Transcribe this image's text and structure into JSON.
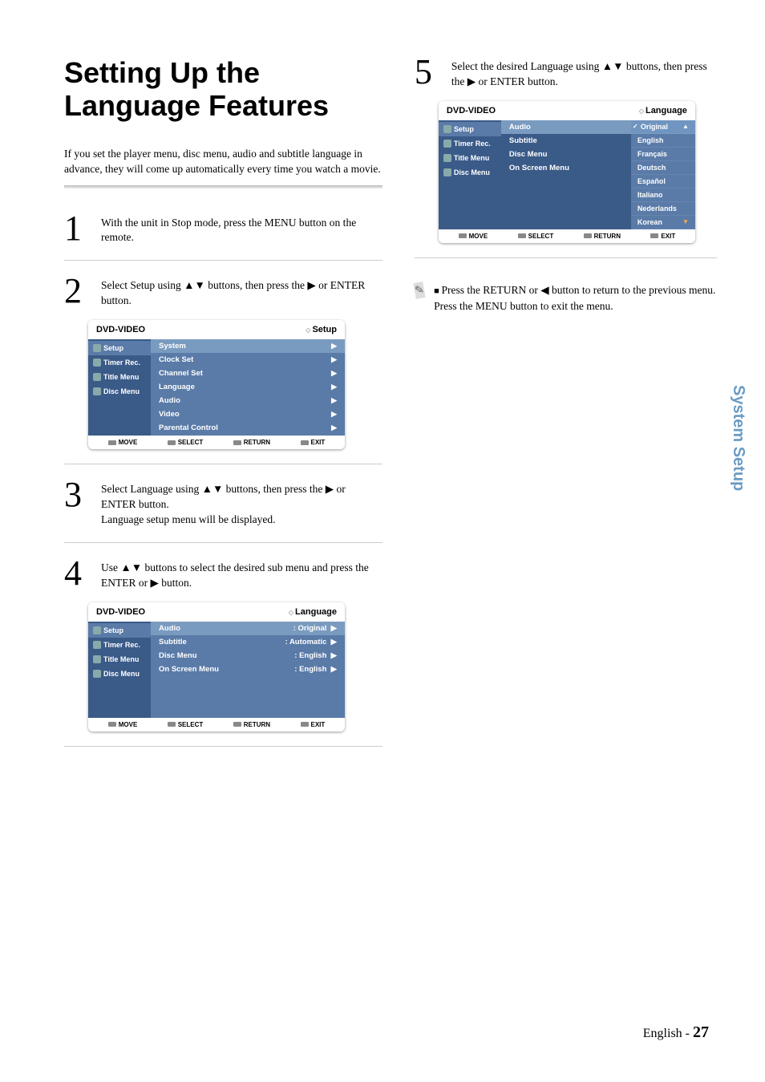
{
  "title": "Setting Up the Language Features",
  "intro": "If you set the player menu, disc menu, audio and subtitle language in advance, they will come up automatically every time you watch a movie.",
  "steps": {
    "s1": {
      "num": "1",
      "text": "With the unit in Stop mode, press the MENU button on the remote."
    },
    "s2": {
      "num": "2",
      "text": "Select Setup using ▲▼ buttons, then press the ▶ or ENTER button."
    },
    "s3": {
      "num": "3",
      "text": "Select Language using ▲▼ buttons, then press the ▶ or ENTER button.",
      "sub": "Language setup menu will be displayed."
    },
    "s4": {
      "num": "4",
      "text": "Use ▲▼ buttons to select the desired sub menu and press the ENTER or ▶ button."
    },
    "s5": {
      "num": "5",
      "text": "Select the desired Language using ▲▼ buttons, then press the ▶ or ENTER button."
    }
  },
  "note": "Press the RETURN or ◀ button to return to the previous menu. Press the MENU button to exit the menu.",
  "menu_common": {
    "header": "DVD-VIDEO",
    "sidebar": [
      "Setup",
      "Timer Rec.",
      "Title Menu",
      "Disc Menu"
    ],
    "footer": {
      "move": "MOVE",
      "select": "SELECT",
      "return": "RETURN",
      "exit": "EXIT"
    }
  },
  "menu_setup": {
    "crumb": "Setup",
    "items": [
      "System",
      "Clock Set",
      "Channel Set",
      "Language",
      "Audio",
      "Video",
      "Parental Control"
    ]
  },
  "menu_lang": {
    "crumb": "Language",
    "rows": [
      {
        "label": "Audio",
        "value": ": Original"
      },
      {
        "label": "Subtitle",
        "value": ": Automatic"
      },
      {
        "label": "Disc Menu",
        "value": ": English"
      },
      {
        "label": "On Screen Menu",
        "value": ": English"
      }
    ]
  },
  "menu_lang_dd": {
    "crumb": "Language",
    "left": [
      "Audio",
      "Subtitle",
      "Disc Menu",
      "On Screen Menu"
    ],
    "options": [
      "Original",
      "English",
      "Français",
      "Deutsch",
      "Español",
      "Italiano",
      "Nederlands",
      "Korean"
    ]
  },
  "side_tab": "System Setup",
  "footer": {
    "lang": "English - ",
    "page": "27"
  }
}
